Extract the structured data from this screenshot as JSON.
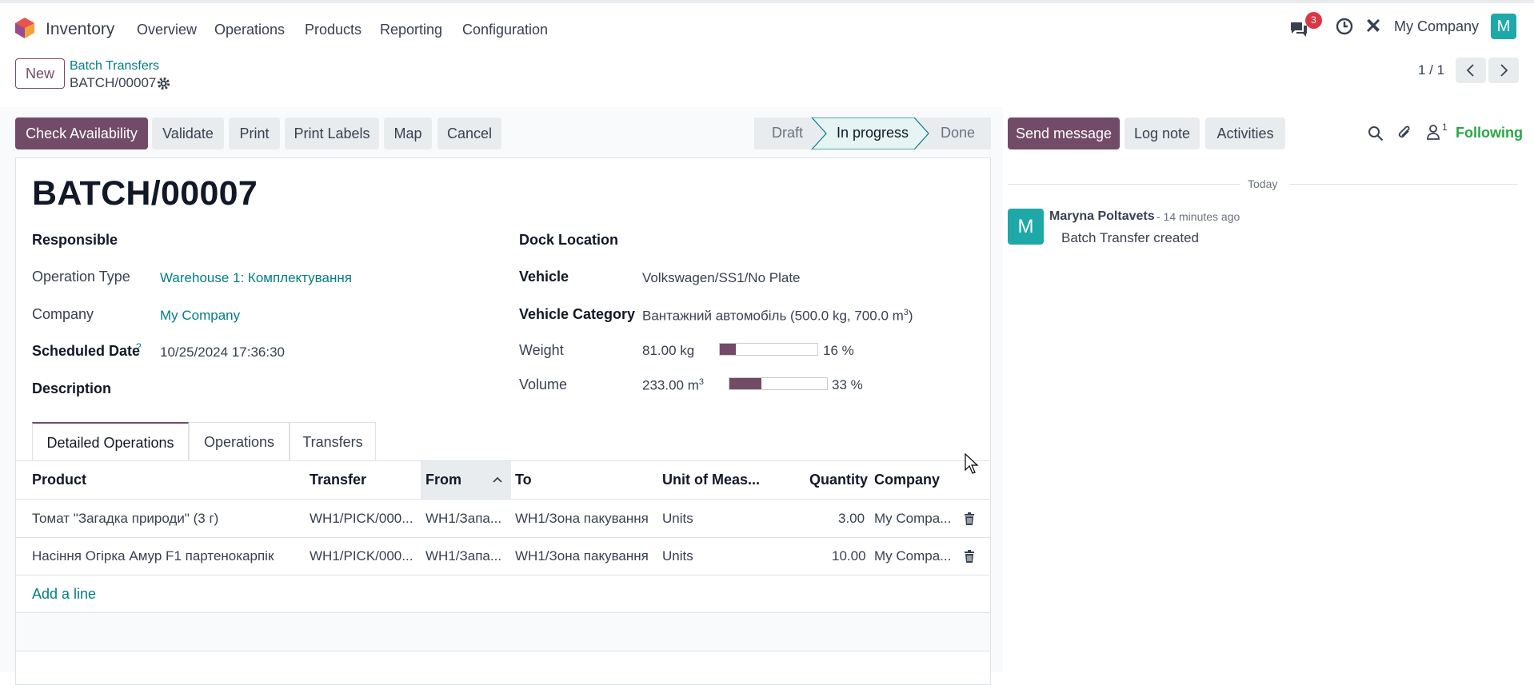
{
  "app": {
    "name": "Inventory",
    "menu": [
      "Overview",
      "Operations",
      "Products",
      "Reporting",
      "Configuration"
    ],
    "notification_count": "3",
    "company": "My Company",
    "user_initial": "M"
  },
  "control_panel": {
    "new_label": "New",
    "breadcrumb_parent": "Batch Transfers",
    "breadcrumb_current": "BATCH/00007",
    "pager": "1 / 1"
  },
  "actions": {
    "check_availability": "Check Availability",
    "validate": "Validate",
    "print": "Print",
    "print_labels": "Print Labels",
    "map": "Map",
    "cancel": "Cancel"
  },
  "statusbar": {
    "stages": [
      "Draft",
      "In progress",
      "Done"
    ],
    "current": "In progress"
  },
  "record": {
    "title": "BATCH/00007",
    "left": {
      "responsible_label": "Responsible",
      "operation_type_label": "Operation Type",
      "operation_type": "Warehouse 1: Комплектування",
      "company_label": "Company",
      "company": "My Company",
      "scheduled_label": "Scheduled Date",
      "scheduled_help": "?",
      "scheduled": "10/25/2024 17:36:30",
      "description_label": "Description"
    },
    "right": {
      "dock_label": "Dock Location",
      "vehicle_label": "Vehicle",
      "vehicle": "Volkswagen/SS1/No Plate",
      "vehicle_category_label": "Vehicle Category",
      "vehicle_category": "Вантажний автомобіль (500.0 kg, 700.0 m",
      "vehicle_category_sup": "3",
      "vehicle_category_end": ")",
      "weight_label": "Weight",
      "weight": "81.00 kg",
      "weight_pct": "16 %",
      "weight_fraction": 0.16,
      "volume_label": "Volume",
      "volume": "233.00 m",
      "volume_sup": "3",
      "volume_pct": "33 %",
      "volume_fraction": 0.33
    }
  },
  "tabs": [
    "Detailed Operations",
    "Operations",
    "Transfers"
  ],
  "table": {
    "columns": [
      "Product",
      "Transfer",
      "From",
      "To",
      "Unit of Meas...",
      "Quantity",
      "Company"
    ],
    "rows": [
      {
        "product": "Томат \"Загадка природи\" (3 г)",
        "transfer": "WH1/PICK/000...",
        "from": "WH1/Запа...",
        "to": "WH1/Зона пакування",
        "uom": "Units",
        "qty": "3.00",
        "company": "My Compa..."
      },
      {
        "product": "Насіння Огірка Амур F1 партенокарпік",
        "transfer": "WH1/PICK/000...",
        "from": "WH1/Запа...",
        "to": "WH1/Зона пакування",
        "uom": "Units",
        "qty": "10.00",
        "company": "My Compa..."
      }
    ],
    "add_line": "Add a line"
  },
  "chatter": {
    "send_message": "Send message",
    "log_note": "Log note",
    "activities": "Activities",
    "follower_count": "1",
    "following": "Following",
    "date_sep": "Today",
    "message": {
      "avatar": "M",
      "author": "Maryna Poltavets",
      "time": "- 14 minutes ago",
      "body": "Batch Transfer created"
    }
  },
  "colors": {
    "primary": "#714b67",
    "link": "#017e84",
    "avatar": "#1fa8a8",
    "following": "#28a745",
    "badge": "#dc3545"
  }
}
